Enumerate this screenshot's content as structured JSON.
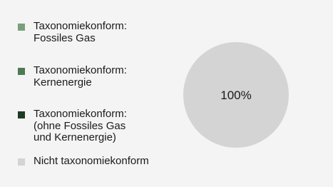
{
  "chart_data": {
    "type": "pie",
    "legend_position": "left",
    "categories": [
      "Taxonomiekonform:\nFossiles Gas",
      "Taxonomiekonform:\nKernenergie",
      "Taxonomiekonform:\n(ohne Fossiles Gas\nund Kernenergie)",
      "Nicht taxonomiekonform"
    ],
    "values": [
      0,
      0,
      0,
      100
    ],
    "colors": [
      "#7a9f7b",
      "#4d7a53",
      "#1e3a24",
      "#d4d4d4"
    ],
    "slice_labels": [
      "",
      "",
      "",
      "100%"
    ]
  }
}
